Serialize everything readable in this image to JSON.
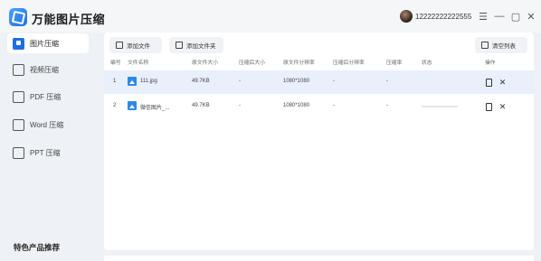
{
  "app": {
    "title": "万能图片压缩"
  },
  "user": {
    "phone": "12222222222555"
  },
  "window_controls": [
    "menu-icon",
    "minimize-icon",
    "maximize-icon",
    "close-icon"
  ],
  "sidebar": {
    "items": [
      {
        "label": "图片压缩",
        "icon": "image-icon",
        "active": true
      },
      {
        "label": "视频压缩",
        "icon": "video-icon",
        "active": false
      },
      {
        "label": "PDF 压缩",
        "icon": "pdf-icon",
        "active": false
      },
      {
        "label": "Word 压缩",
        "icon": "word-icon",
        "active": false
      },
      {
        "label": "PPT 压缩",
        "icon": "ppt-icon",
        "active": false
      }
    ],
    "promo_title": "特色产品推荐"
  },
  "toolbar": {
    "add_file": "添加文件",
    "add_folder": "添加文件夹",
    "clear_list": "清空列表"
  },
  "table": {
    "headers": [
      "编号",
      "文件名称",
      "原文件大小",
      "压缩后大小",
      "原文件分辨率",
      "压缩后分辨率",
      "压缩率",
      "状态",
      "操作"
    ],
    "rows": [
      {
        "index": "1",
        "name": "111.jpg",
        "size": "49.7KB",
        "compressed_size": "-",
        "resolution": "1080*1080",
        "compressed_resolution": "-",
        "ratio": "-",
        "status": "",
        "selected": true
      },
      {
        "index": "2",
        "name": "微信图片_...",
        "size": "49.7KB",
        "compressed_size": "-",
        "resolution": "1080*1080",
        "compressed_resolution": "-",
        "ratio": "-",
        "status": "",
        "selected": false
      }
    ]
  },
  "colors": {
    "accent": "#1e6ee8",
    "selected_row": "#e8f0fc",
    "file_icon": "#2e8ae6"
  }
}
